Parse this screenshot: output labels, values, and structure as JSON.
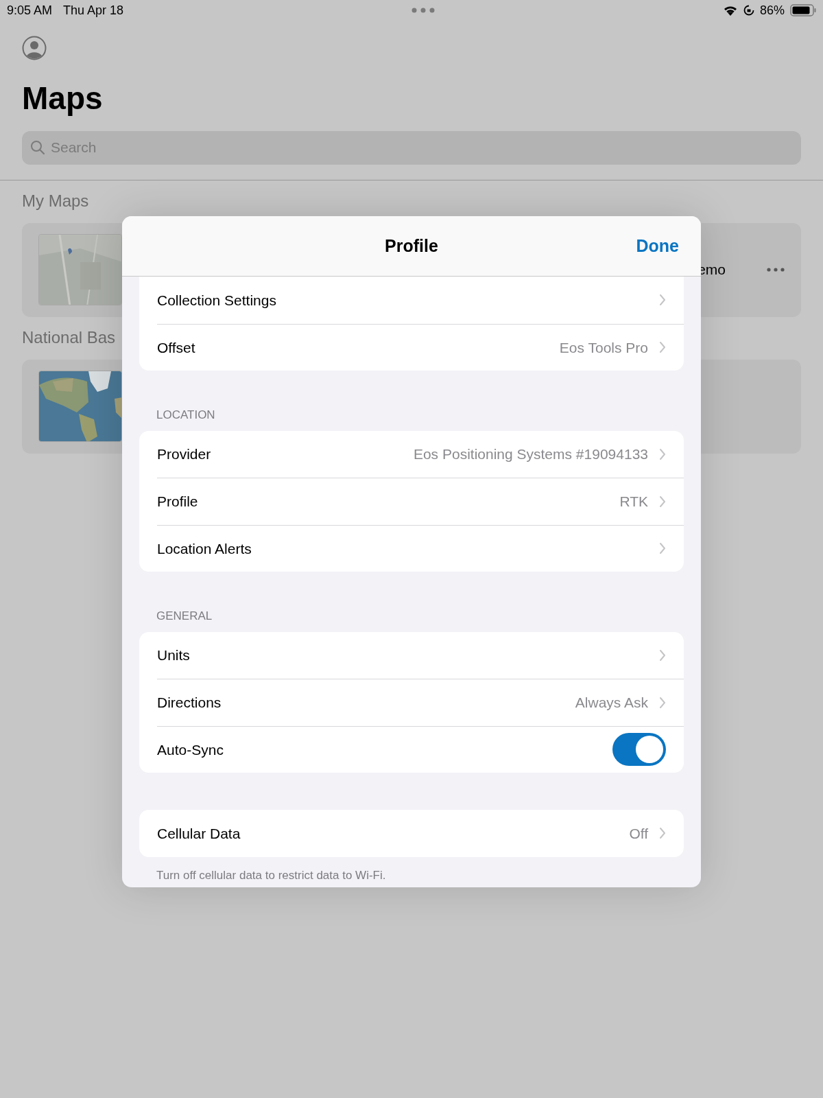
{
  "status_bar": {
    "time": "9:05 AM",
    "date": "Thu Apr 18",
    "battery": "86%"
  },
  "background": {
    "title": "Maps",
    "search": {
      "placeholder": "Search"
    },
    "sections": [
      {
        "title": "My Maps",
        "item": {
          "name": "emo",
          "kind": "picture"
        }
      },
      {
        "title": "National Bas"
      }
    ]
  },
  "modal": {
    "title": "Profile",
    "done": "Done",
    "groups": [
      {
        "rows": [
          {
            "kind": "link",
            "label": "Collection Settings"
          },
          {
            "kind": "link",
            "label": "Offset",
            "value": "Eos Tools Pro"
          }
        ]
      },
      {
        "header": "LOCATION",
        "rows": [
          {
            "kind": "link",
            "label": "Provider",
            "value": "Eos Positioning Systems #19094133"
          },
          {
            "kind": "link",
            "label": "Profile",
            "value": "RTK"
          },
          {
            "kind": "link",
            "label": "Location Alerts"
          }
        ]
      },
      {
        "header": "GENERAL",
        "rows": [
          {
            "kind": "link",
            "label": "Units"
          },
          {
            "kind": "link",
            "label": "Directions",
            "value": "Always Ask"
          },
          {
            "kind": "toggle",
            "label": "Auto-Sync",
            "on": true
          }
        ]
      },
      {
        "rows": [
          {
            "kind": "link",
            "label": "Cellular Data",
            "value": "Off"
          }
        ],
        "footer": "Turn off cellular data to restrict data to Wi-Fi."
      }
    ]
  }
}
